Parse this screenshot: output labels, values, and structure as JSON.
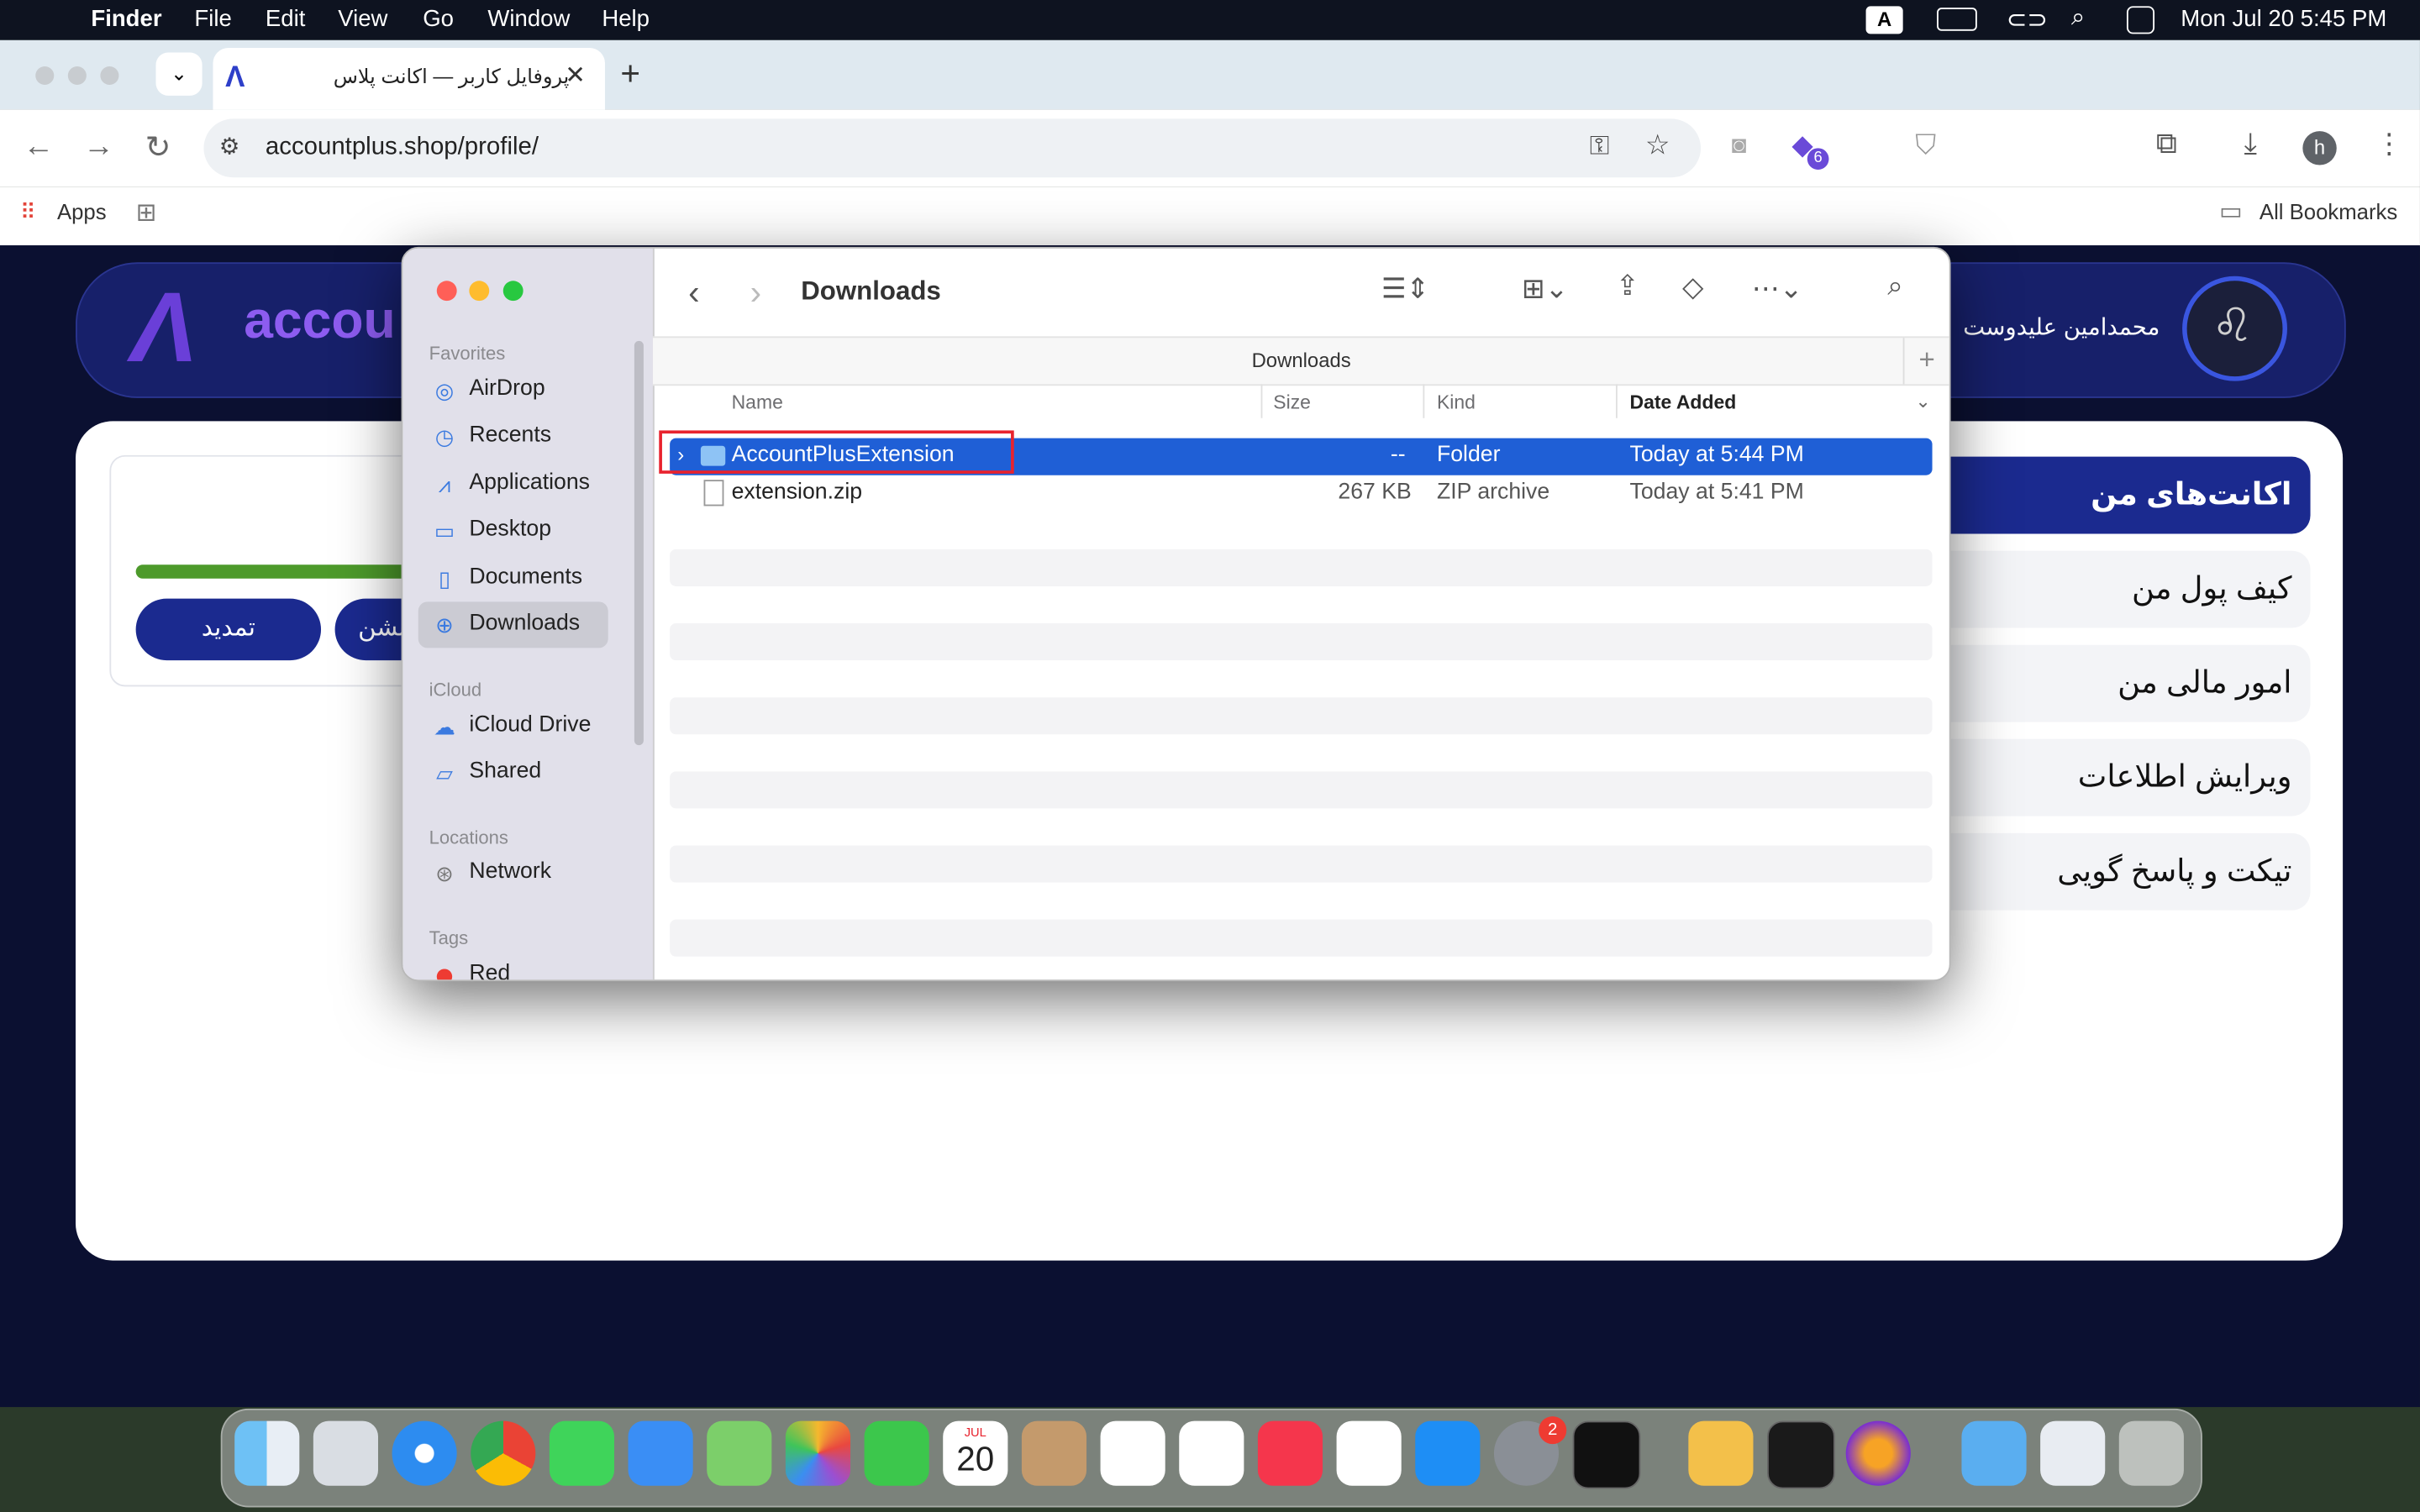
{
  "menubar": {
    "app": "Finder",
    "items": [
      "File",
      "Edit",
      "View",
      "Go",
      "Window",
      "Help"
    ],
    "clock": "Mon Jul 20  5:45 PM",
    "input_source": "A"
  },
  "browser": {
    "tab_title": "پروفایل کاربر — اکانت پلاس",
    "url": "accountplus.shop/profile/",
    "bookmarks_apps": "Apps",
    "all_bookmarks": "All Bookmarks",
    "profile_initial": "h",
    "extension_badge": "6"
  },
  "website": {
    "logo_text": "accou",
    "username": "محمدامین علیدوست",
    "buttons": {
      "renew": "تمدید",
      "partial": "نشن"
    },
    "nav": [
      "اکانت‌های من",
      "کیف پول من",
      "امور مالی من",
      "ویرایش اطلاعات",
      "تیکت و پاسخ گویی"
    ]
  },
  "finder": {
    "title": "Downloads",
    "path_bar": "Downloads",
    "sidebar": {
      "favorites_header": "Favorites",
      "favorites": [
        "AirDrop",
        "Recents",
        "Applications",
        "Desktop",
        "Documents",
        "Downloads"
      ],
      "icloud_header": "iCloud",
      "icloud": [
        "iCloud Drive",
        "Shared"
      ],
      "locations_header": "Locations",
      "locations": [
        "Network"
      ],
      "tags_header": "Tags",
      "tags": [
        "Red"
      ]
    },
    "columns": {
      "name": "Name",
      "size": "Size",
      "kind": "Kind",
      "date": "Date Added"
    },
    "files": [
      {
        "name": "AccountPlusExtension",
        "size": "--",
        "kind": "Folder",
        "date": "Today at 5:44 PM"
      },
      {
        "name": "extension.zip",
        "size": "267 KB",
        "kind": "ZIP archive",
        "date": "Today at 5:41 PM"
      }
    ]
  },
  "dock": {
    "calendar_month": "JUL",
    "calendar_day": "20",
    "settings_badge": "2"
  },
  "colors": {
    "selection": "#1f5fd6",
    "highlight_box": "#e8232e",
    "site_navy": "#1b2a8f",
    "site_bg": "#0b1031"
  }
}
